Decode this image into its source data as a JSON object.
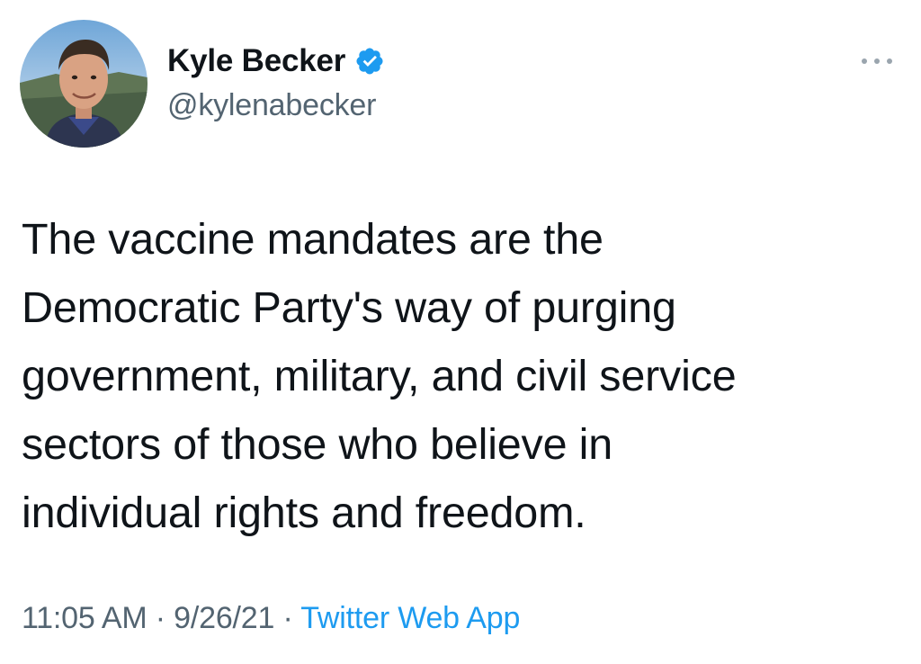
{
  "author": {
    "display_name": "Kyle Becker",
    "handle": "@kylenabecker",
    "verified": true,
    "avatar_icon": "profile-photo-icon",
    "verified_icon": "verified-badge-icon",
    "verified_color": "#1d9bf0"
  },
  "tweet": {
    "text_lines": [
      "The vaccine mandates are the",
      "Democratic Party's way of purging",
      "government, military, and civil service",
      "sectors of those who believe in",
      "individual rights and freedom."
    ]
  },
  "meta": {
    "time": "11:05 AM",
    "separator": "·",
    "date": "9/26/21",
    "source": "Twitter Web App",
    "source_color": "#1d9bf0"
  },
  "menu": {
    "icon": "more-options-icon"
  }
}
